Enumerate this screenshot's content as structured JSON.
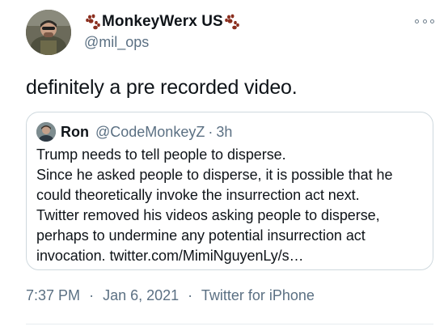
{
  "author": {
    "display_name": "MonkeyWerx US",
    "handle": "@mil_ops",
    "name_decoration_icon": "paw-prints-icon",
    "verified": false
  },
  "tweet": {
    "text": "definitely a pre recorded video."
  },
  "quoted_tweet": {
    "display_name": "Ron",
    "handle": "@CodeMonkeyZ",
    "separator": "·",
    "time": "3h",
    "lines": [
      "Trump needs to tell people to disperse.",
      "Since he asked people to disperse, it is possible that he",
      "could theoretically invoke the insurrection act next.",
      "Twitter removed his videos asking people to disperse,",
      "perhaps to undermine any potential insurrection act",
      "invocation. twitter.com/MimiNguyenLy/s…"
    ]
  },
  "meta": {
    "time": "7:37 PM",
    "date": "Jan 6, 2021",
    "source": "Twitter for iPhone",
    "separator": "·"
  },
  "colors": {
    "text_primary": "#0f1419",
    "text_secondary": "#5b7083",
    "border": "#cfd9de",
    "paw": "#8b2f1f"
  },
  "icons": {
    "more": "more-options-icon"
  }
}
